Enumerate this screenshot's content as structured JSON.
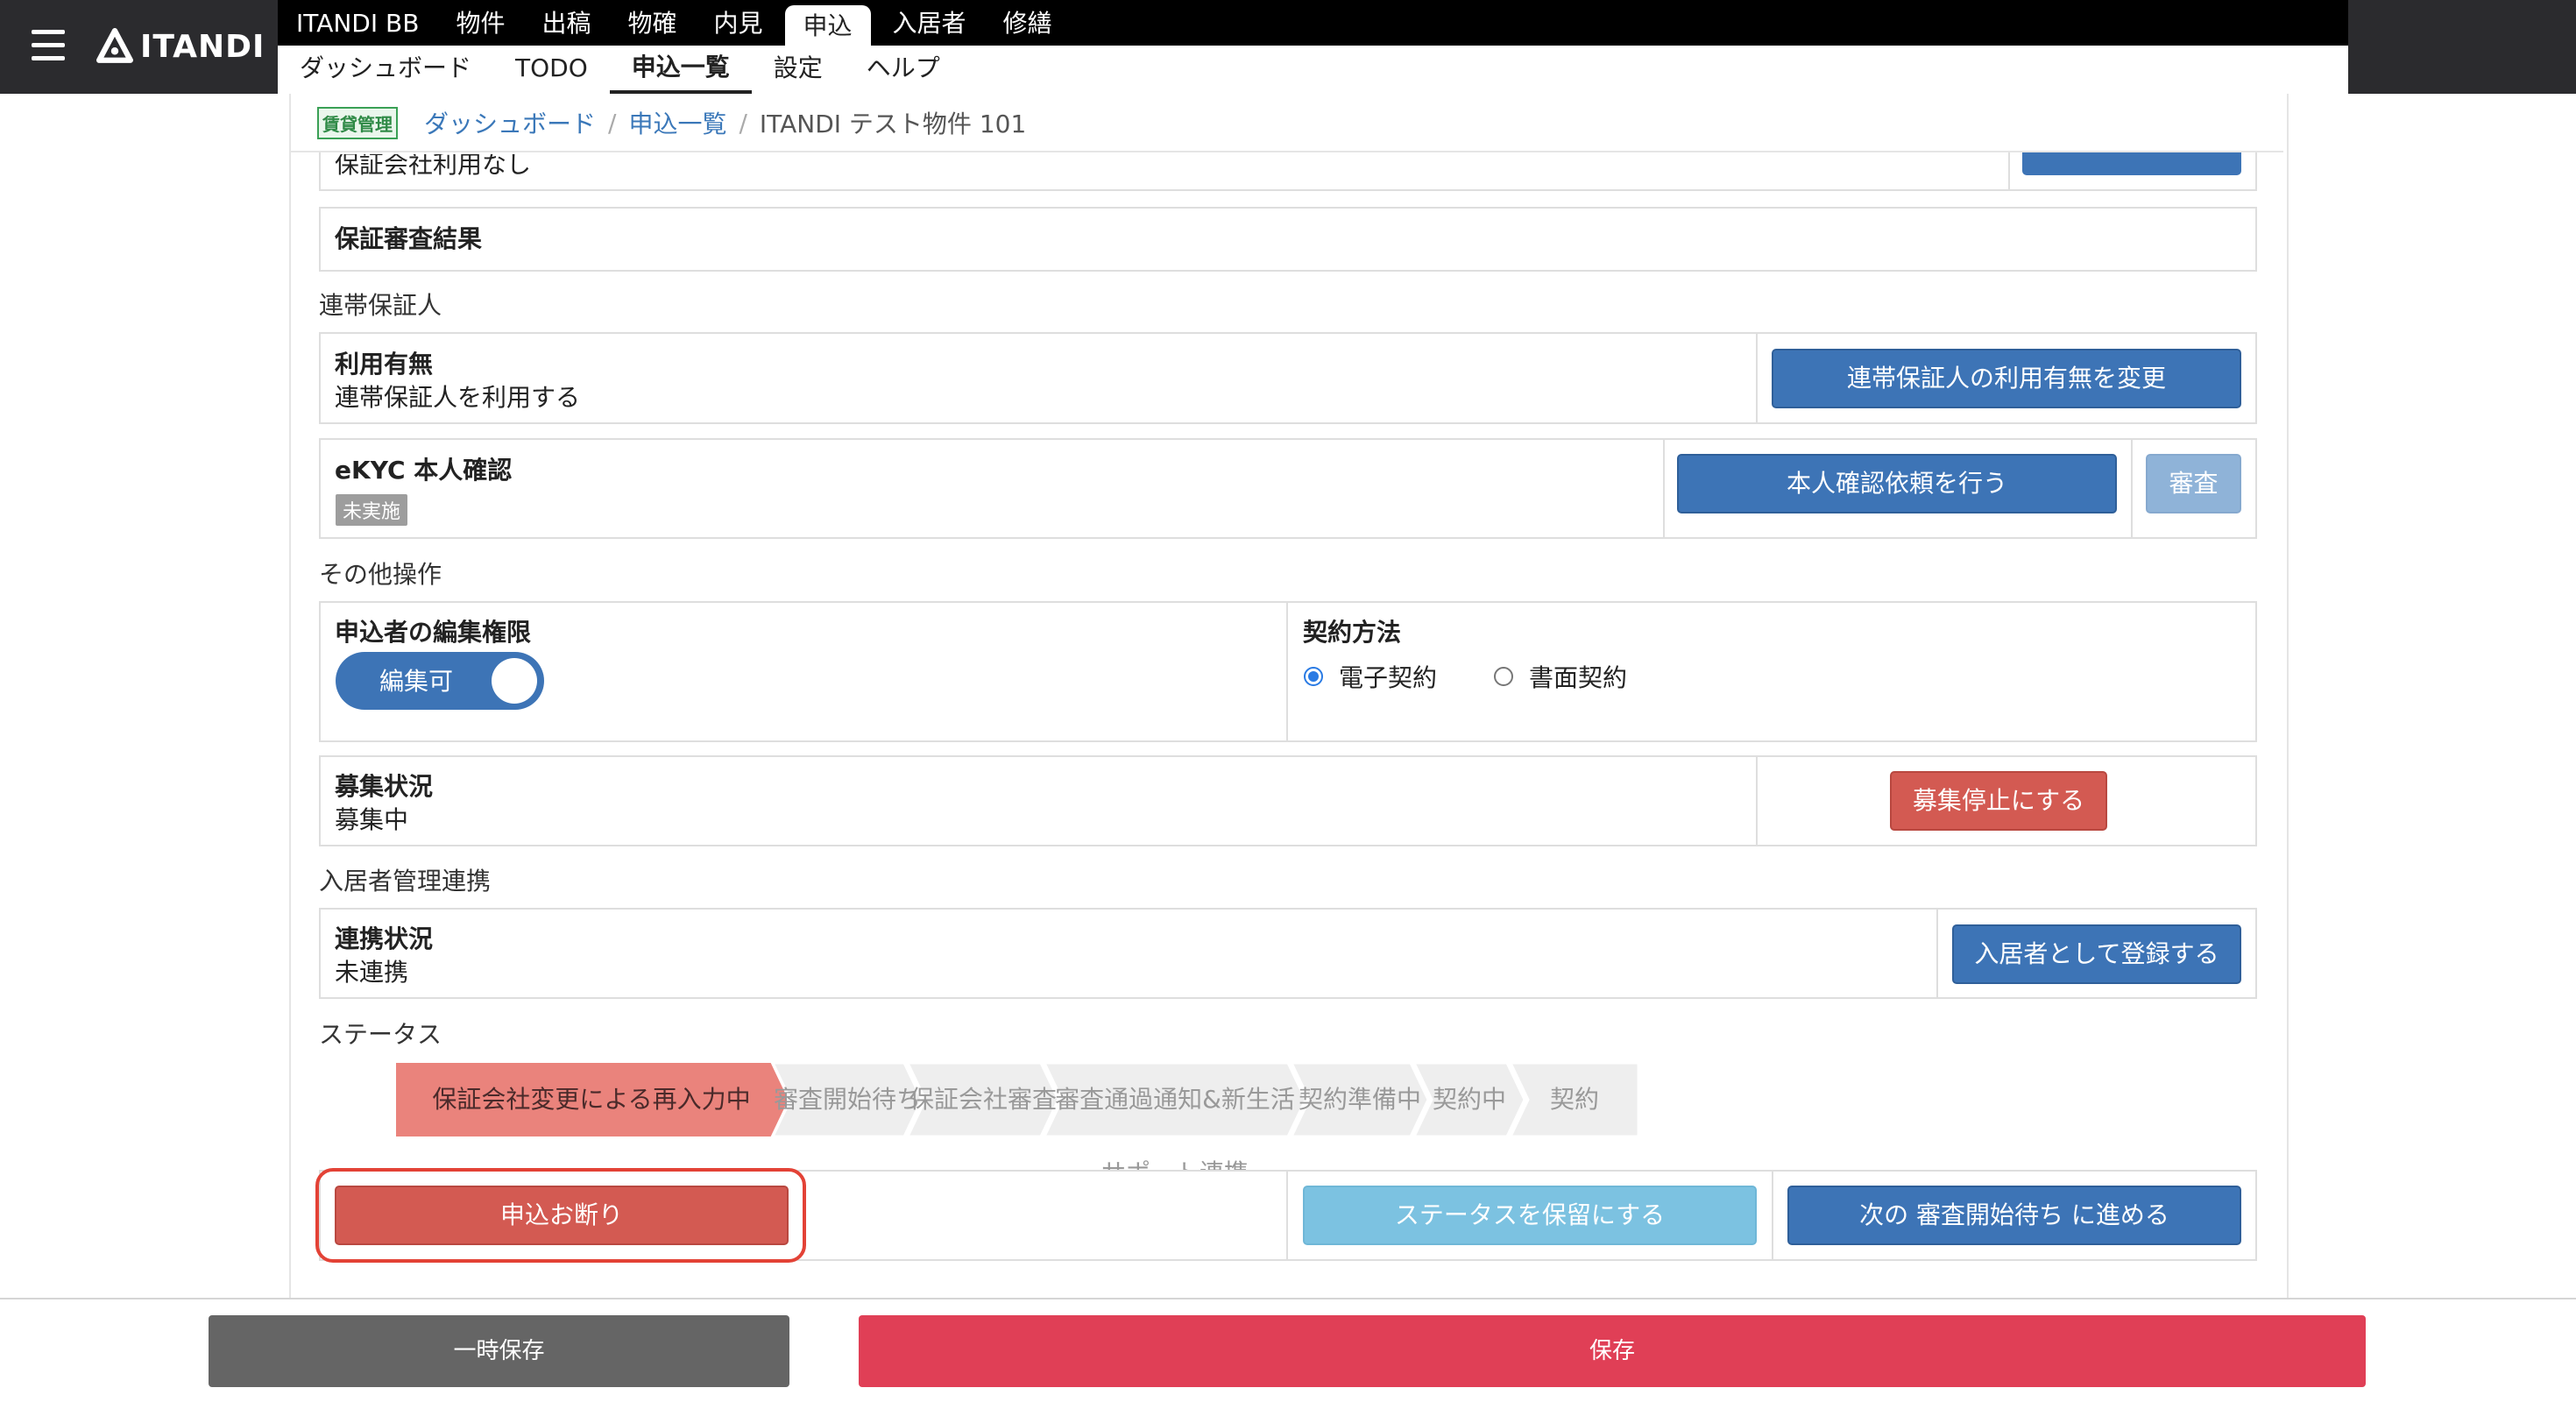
{
  "app": {
    "logo_text": "ITANDI"
  },
  "main_nav": [
    "ITANDI BB",
    "物件",
    "出稿",
    "物確",
    "内見",
    "申込",
    "入居者",
    "修繕"
  ],
  "main_nav_active": "申込",
  "sub_nav": [
    "ダッシュボード",
    "TODO",
    "申込一覧",
    "設定",
    "ヘルプ"
  ],
  "sub_nav_active": "申込一覧",
  "breadcrumb": {
    "badge": "賃貸管理",
    "items": [
      "ダッシュボード",
      "申込一覧"
    ],
    "current": "ITANDI テスト物件 101"
  },
  "guarantee": {
    "partial_value": "保証会社利用なし",
    "result_label": "保証審査結果"
  },
  "joint_guarantor": {
    "section": "連帯保証人",
    "usage_label": "利用有無",
    "usage_value": "連帯保証人を利用する",
    "change_button": "連帯保証人の利用有無を変更",
    "ekyc_label": "eKYC 本人確認",
    "ekyc_status": "未実施",
    "request_button": "本人確認依頼を行う",
    "review_button": "審査"
  },
  "other_ops": {
    "section": "その他操作",
    "edit_perm_label": "申込者の編集権限",
    "edit_toggle": "編集可",
    "contract_label": "契約方法",
    "contract_options": [
      "電子契約",
      "書面契約"
    ],
    "contract_selected": "電子契約",
    "recruit_label": "募集状況",
    "recruit_value": "募集中",
    "recruit_button": "募集停止にする"
  },
  "tenant_link": {
    "section": "入居者管理連携",
    "status_label": "連携状況",
    "status_value": "未連携",
    "register_button": "入居者として登録する"
  },
  "status": {
    "section": "ステータス",
    "steps": [
      "保証会社変更による再入力中",
      "審査開始待ち",
      "保証会社審査",
      "審査通過通知&新生活サポート連携",
      "契約準備中",
      "契約中",
      "契約"
    ],
    "active_index": 0,
    "decline_button": "申込お断り",
    "hold_button": "ステータスを保留にする",
    "next_button": "次の 審査開始待ち に進める"
  },
  "footer": {
    "temp_save": "一時保存",
    "save": "保存"
  },
  "colors": {
    "primary": "#3d74b6",
    "danger": "#d35a52",
    "save": "#e03f56",
    "active_step": "#ea837c",
    "inactive_step": "#eeeeee"
  }
}
